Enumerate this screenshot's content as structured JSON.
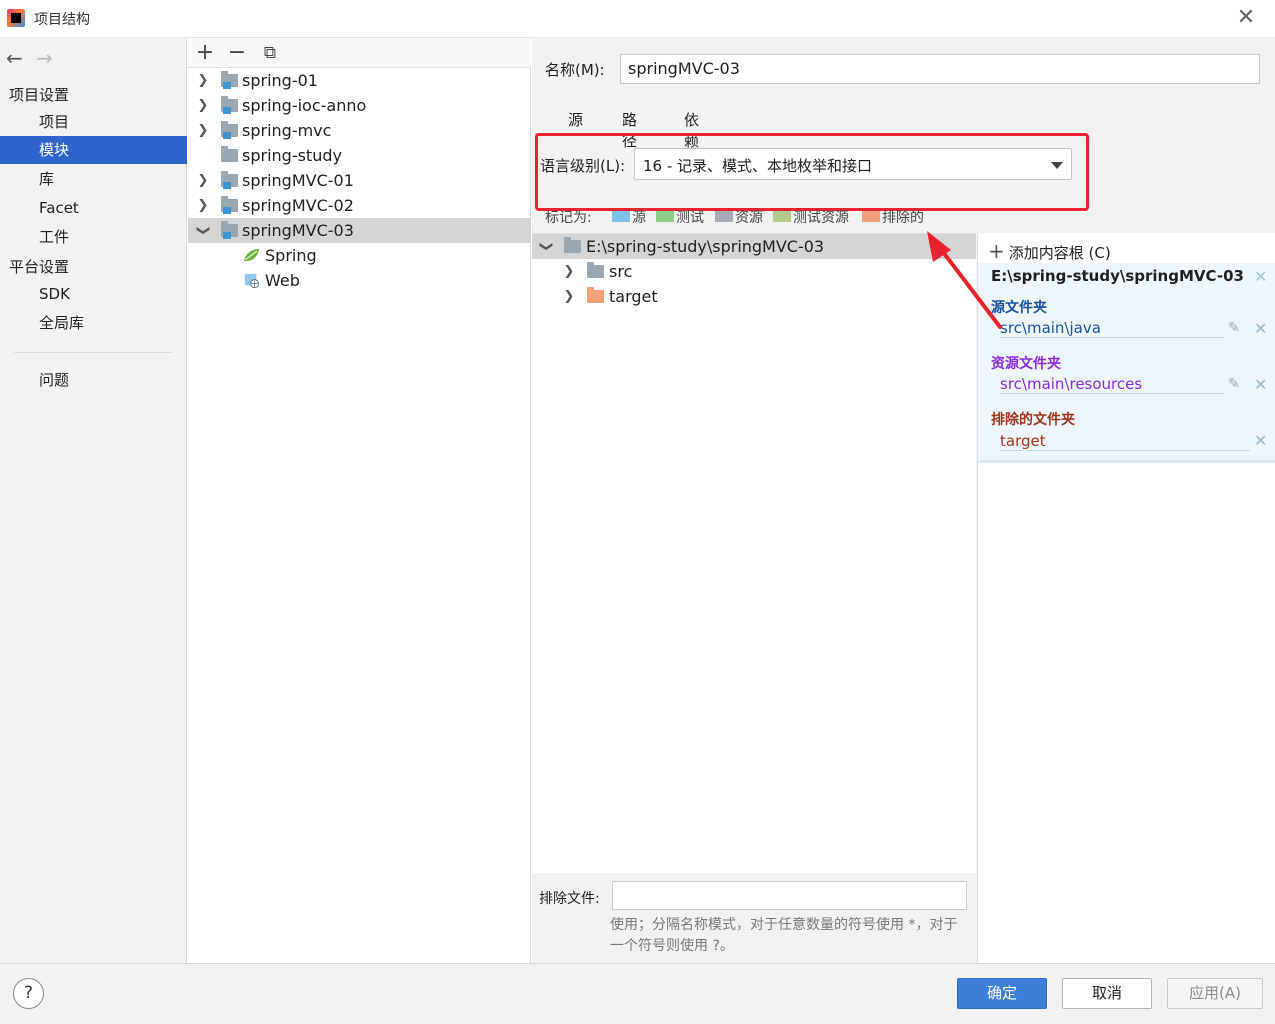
{
  "window": {
    "title": "项目结构",
    "close_glyph": "✕"
  },
  "nav": {
    "back_glyph": "←",
    "forward_glyph": "→",
    "project_settings": "项目设置",
    "project": "项目",
    "modules": "模块",
    "libraries": "库",
    "facet": "Facet",
    "artifacts": "工件",
    "platform_settings": "平台设置",
    "sdk": "SDK",
    "global_libraries": "全局库",
    "problems": "问题"
  },
  "module_toolbar": {
    "add": "+",
    "remove": "−",
    "copy": "⧉"
  },
  "modules": [
    {
      "name": "spring-01",
      "expandable": true
    },
    {
      "name": "spring-ioc-anno",
      "expandable": true
    },
    {
      "name": "spring-mvc",
      "expandable": true
    },
    {
      "name": "spring-study",
      "expandable": false
    },
    {
      "name": "springMVC-01",
      "expandable": true
    },
    {
      "name": "springMVC-02",
      "expandable": true
    },
    {
      "name": "springMVC-03",
      "expandable": true,
      "expanded": true,
      "selected": true
    }
  ],
  "module_children": [
    "Spring",
    "Web"
  ],
  "name_field": {
    "label": "名称(M):",
    "value": "springMVC-03"
  },
  "tabs": [
    "源",
    "路径",
    "依赖"
  ],
  "language_level": {
    "label": "语言级别(L):",
    "value": "16 - 记录、模式、本地枚举和接口"
  },
  "mark_as": {
    "label": "标记为:",
    "items": [
      {
        "label": "源",
        "color": "#7ec3e6"
      },
      {
        "label": "测试",
        "color": "#8fce8b"
      },
      {
        "label": "资源",
        "color": "#a6adb5"
      },
      {
        "label": "测试资源",
        "color": "#b5c98f"
      },
      {
        "label": "排除的",
        "color": "#f2a07a"
      }
    ]
  },
  "content_tree": {
    "root": "E:\\spring-study\\springMVC-03",
    "children": [
      "src",
      "target"
    ]
  },
  "exclude_files": {
    "label": "排除文件:",
    "value": "",
    "hint": "使用；分隔名称模式，对于任意数量的符号使用 *，对于一个符号则使用 ?。"
  },
  "content_roots": {
    "add_label": "添加内容根 (C)",
    "path": "E:\\spring-study\\springMVC-03",
    "source_header": "源文件夹",
    "source_path": "src\\main\\java",
    "resource_header": "资源文件夹",
    "resource_path": "src\\main\\resources",
    "excluded_header": "排除的文件夹",
    "excluded_path": "target",
    "colors": {
      "source": "#1a4f9c",
      "resource": "#8a2be2",
      "excluded": "#a0341b"
    }
  },
  "buttons": {
    "help": "?",
    "ok": "确定",
    "cancel": "取消",
    "apply": "应用(A)"
  }
}
